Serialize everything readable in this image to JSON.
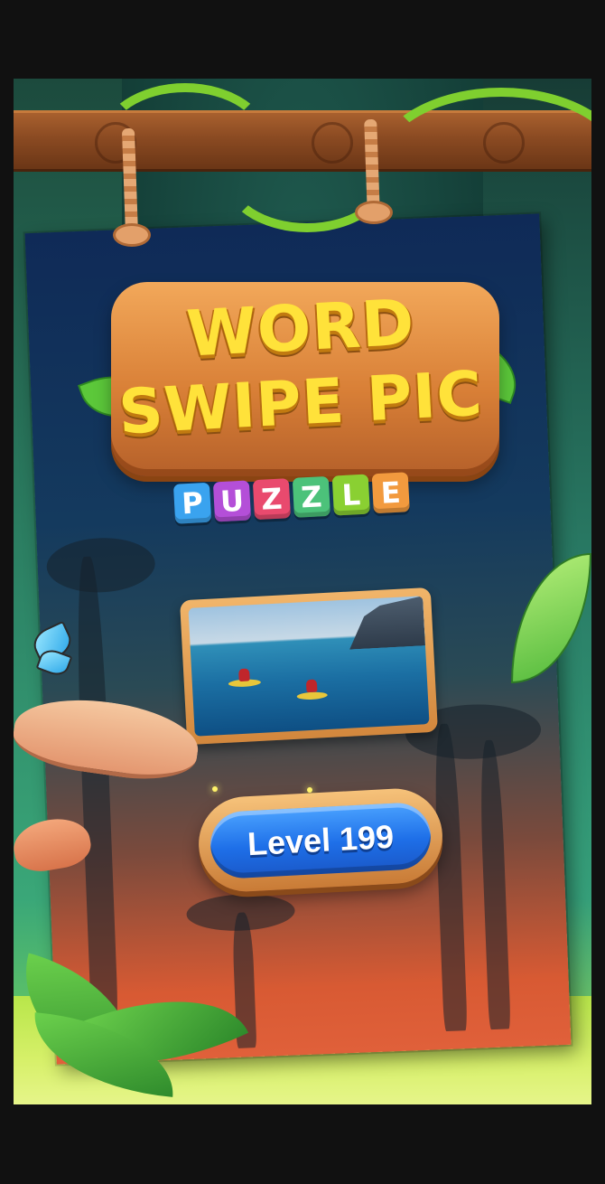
{
  "logo": {
    "line1": "WORD",
    "line2": "SWIPE PIC",
    "tiles": [
      {
        "letter": "P",
        "color": "#3aa3ef"
      },
      {
        "letter": "U",
        "color": "#b44fd8"
      },
      {
        "letter": "Z",
        "color": "#e94a6e"
      },
      {
        "letter": "Z",
        "color": "#4cc27a"
      },
      {
        "letter": "L",
        "color": "#8ad032"
      },
      {
        "letter": "E",
        "color": "#f29a3e"
      }
    ]
  },
  "preview": {
    "icon": "kayak-photo"
  },
  "level_button": {
    "label": "Level 199"
  },
  "colors": {
    "accent": "#1e6fe8",
    "logo_text": "#ffe23a",
    "frame": "#d98037"
  }
}
